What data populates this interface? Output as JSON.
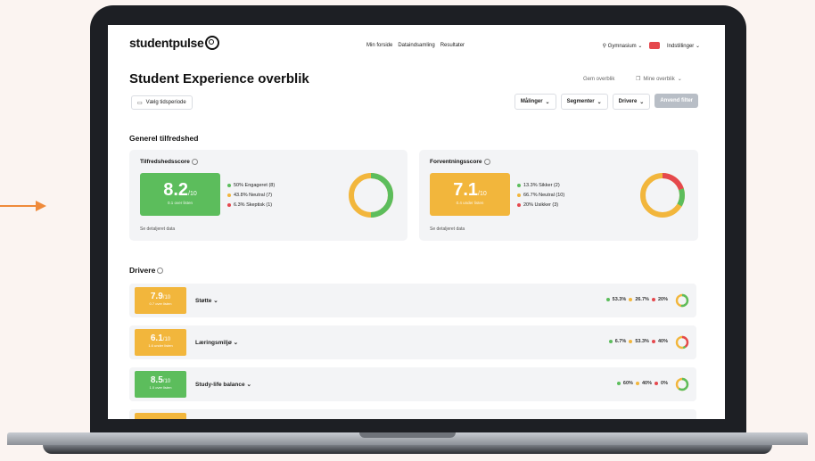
{
  "colors": {
    "green": "#5cbd5c",
    "amber": "#f2b63c",
    "red": "#e5484d",
    "accent_arrow": "#ef8a3a"
  },
  "app": {
    "logo": "studentpulse",
    "nav": [
      "Min forside",
      "Dataindsamling",
      "Resultater"
    ],
    "org": "Gymnasium",
    "settings": "Indstillinger"
  },
  "page": {
    "title": "Student Experience overblik",
    "period_button": "Vælg tidsperiode",
    "save_link": "Gem overblik",
    "my_overview": "Mine overblik",
    "filters": [
      "Målinger",
      "Segmenter",
      "Drivere"
    ],
    "apply_filters": "Anvend filter"
  },
  "general": {
    "section_title": "Generel tilfredshed",
    "satisfaction": {
      "title": "Tilfredshedsscore",
      "score": "8.2",
      "scale": "/10",
      "sub": "0.1 over listen",
      "legend": [
        {
          "label": "50% Engageret (8)",
          "color": "green"
        },
        {
          "label": "43.8% Neutral (7)",
          "color": "amber"
        },
        {
          "label": "6.3% Skeptisk (1)",
          "color": "red"
        }
      ],
      "detail_link": "Se detaljeret data"
    },
    "expectation": {
      "title": "Forventningsscore",
      "score": "7.1",
      "scale": "/10",
      "sub": "0.4 under listen",
      "legend": [
        {
          "label": "13.3% Sikker (2)",
          "color": "green"
        },
        {
          "label": "66.7% Neutral (10)",
          "color": "amber"
        },
        {
          "label": "20% Usikker (3)",
          "color": "red"
        }
      ],
      "detail_link": "Se detaljeret data"
    }
  },
  "drivers": {
    "section_title": "Drivere",
    "items": [
      {
        "name": "Støtte",
        "score": "7.9",
        "scale": "/10",
        "sub": "0.7 over listen",
        "tier": "amber",
        "stats": [
          "53.3%",
          "26.7%",
          "20%"
        ]
      },
      {
        "name": "Læringsmiljø",
        "score": "6.1",
        "scale": "/10",
        "sub": "1.6 under listen",
        "tier": "amber",
        "stats": [
          "6.7%",
          "53.3%",
          "40%"
        ]
      },
      {
        "name": "Study-life balance",
        "score": "8.5",
        "scale": "/10",
        "sub": "1.0 over listen",
        "tier": "green",
        "stats": [
          "60%",
          "40%",
          "0%"
        ]
      }
    ]
  }
}
